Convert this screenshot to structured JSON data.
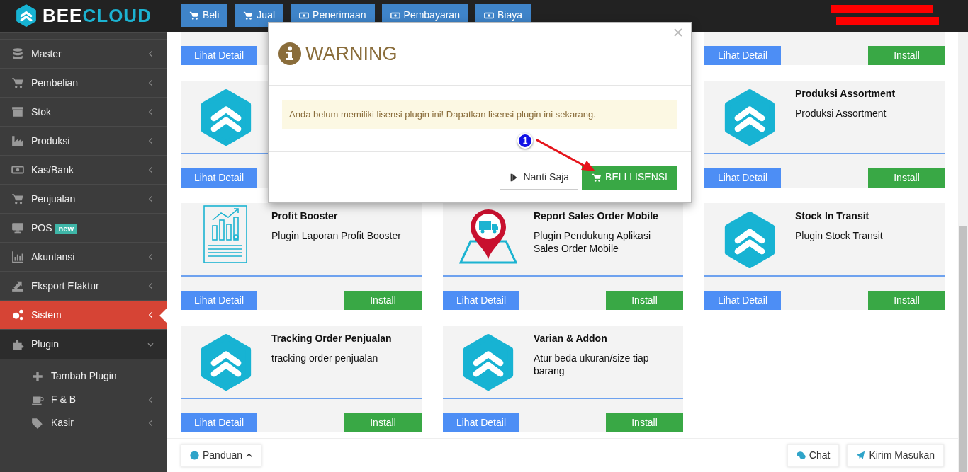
{
  "brand": {
    "name_first": "BEE",
    "name_second": "CLOUD"
  },
  "top_nav": [
    {
      "label": "Beli"
    },
    {
      "label": "Jual"
    },
    {
      "label": "Penerimaan"
    },
    {
      "label": "Pembayaran"
    },
    {
      "label": "Biaya"
    }
  ],
  "sidebar": {
    "items": [
      {
        "label": "Master",
        "submenu": true,
        "selected": false,
        "expanded": false
      },
      {
        "label": "Pembelian",
        "submenu": true,
        "selected": false,
        "expanded": false
      },
      {
        "label": "Stok",
        "submenu": true,
        "selected": false,
        "expanded": false
      },
      {
        "label": "Produksi",
        "submenu": true,
        "selected": false,
        "expanded": false
      },
      {
        "label": "Kas/Bank",
        "submenu": true,
        "selected": false,
        "expanded": false
      },
      {
        "label": "Penjualan",
        "submenu": true,
        "selected": false,
        "expanded": false
      },
      {
        "label": "POS",
        "badge": "new",
        "submenu": false,
        "selected": false,
        "expanded": false
      },
      {
        "label": "Akuntansi",
        "submenu": true,
        "selected": false,
        "expanded": false
      },
      {
        "label": "Eksport Efaktur",
        "submenu": true,
        "selected": false,
        "expanded": false
      },
      {
        "label": "Sistem",
        "submenu": true,
        "selected": true,
        "expanded": false
      },
      {
        "label": "Plugin",
        "submenu": true,
        "selected": false,
        "expanded": true,
        "children": [
          {
            "label": "Tambah Plugin",
            "submenu": false,
            "selected": false,
            "expanded": false
          },
          {
            "label": "F & B",
            "submenu": true,
            "selected": false,
            "expanded": false
          },
          {
            "label": "Kasir",
            "submenu": true,
            "selected": false,
            "expanded": false
          }
        ]
      }
    ]
  },
  "plugin_rows": [
    {
      "cards": [
        {
          "detail_button": "Lihat Detail"
        },
        {
          "detail_button": "Lihat Detail",
          "install_button": "Install"
        }
      ]
    },
    {
      "cards": [
        {
          "kind": "logo",
          "detail_button": "Lihat Detail"
        },
        {
          "kind": "logo",
          "title": "Produksi Assortment",
          "description": "Produksi Assortment",
          "detail_button": "Lihat Detail",
          "install_button": "Install"
        }
      ]
    },
    {
      "cards": [
        {
          "kind": "report",
          "title": "Profit Booster",
          "description": "Plugin Laporan Profit Booster",
          "detail_button": "Lihat Detail",
          "install_button": "Install"
        },
        {
          "kind": "map",
          "title": "Report Sales Order Mobile",
          "description": "Plugin Pendukung Aplikasi Sales Order Mobile",
          "detail_button": "Lihat Detail",
          "install_button": "Install"
        },
        {
          "kind": "logo",
          "title": "Stock In Transit",
          "description": "Plugin Stock Transit",
          "detail_button": "Lihat Detail",
          "install_button": "Install"
        }
      ]
    },
    {
      "cards": [
        {
          "kind": "logo",
          "title": "Tracking Order Penjualan",
          "description": "tracking order penjualan",
          "detail_button": "Lihat Detail",
          "install_button": "Install"
        },
        {
          "kind": "logo",
          "title": "Varian & Addon",
          "description": "Atur beda ukuran/size tiap barang",
          "detail_button": "Lihat Detail",
          "install_button": "Install"
        }
      ]
    }
  ],
  "footer": {
    "left": [
      {
        "label": "Panduan"
      }
    ],
    "right": [
      {
        "label": "Chat"
      },
      {
        "label": "Kirim Masukan"
      }
    ]
  },
  "modal": {
    "title": "WARNING",
    "message": "Anda belum memiliki lisensi plugin ini! Dapatkan lisensi plugin ini sekarang.",
    "buttons": [
      {
        "label": "Nanti Saja",
        "kind": "secondary"
      },
      {
        "label": "BELI LISENSI",
        "kind": "primary"
      }
    ]
  },
  "annotation": {
    "label": "1"
  }
}
